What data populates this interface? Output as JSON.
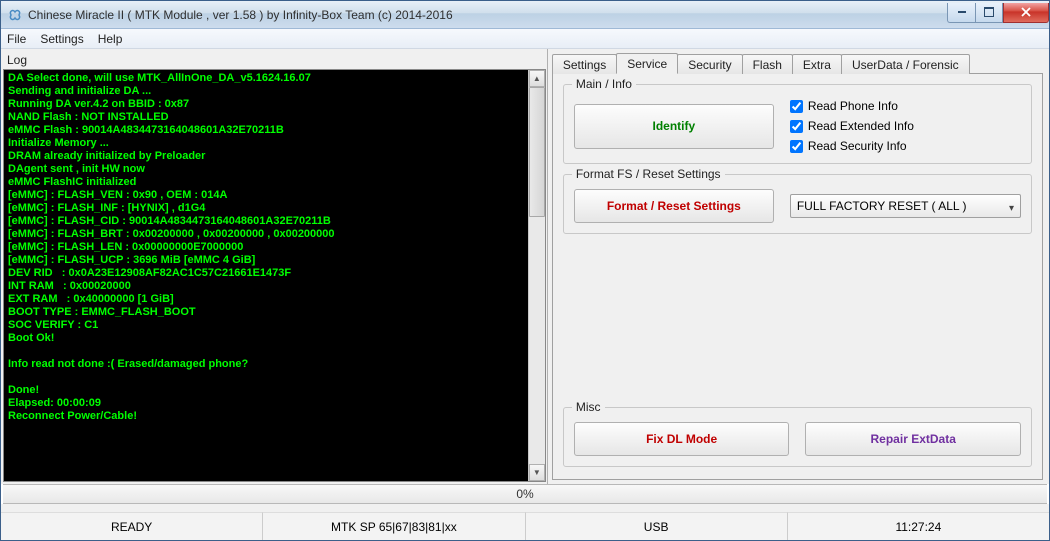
{
  "window": {
    "title": "Chinese Miracle II ( MTK Module , ver 1.58 ) by Infinity-Box Team (c) 2014-2016"
  },
  "menu": {
    "file": "File",
    "settings": "Settings",
    "help": "Help"
  },
  "log": {
    "label": "Log",
    "lines": "DA Select done, will use MTK_AllInOne_DA_v5.1624.16.07\nSending and initialize DA ...\nRunning DA ver.4.2 on BBID : 0x87\nNAND Flash : NOT INSTALLED\neMMC Flash : 90014A4834473164048601A32E70211B\nInitialize Memory ...\nDRAM already initialized by Preloader\nDAgent sent , init HW now\neMMC FlashIC initialized\n[eMMC] : FLASH_VEN : 0x90 , OEM : 014A\n[eMMC] : FLASH_INF : [HYNIX] , d1G4\n[eMMC] : FLASH_CID : 90014A4834473164048601A32E70211B\n[eMMC] : FLASH_BRT : 0x00200000 , 0x00200000 , 0x00200000\n[eMMC] : FLASH_LEN : 0x00000000E7000000\n[eMMC] : FLASH_UCP : 3696 MiB [eMMC 4 GiB]\nDEV RID   : 0x0A23E12908AF82AC1C57C21661E1473F\nINT RAM   : 0x00020000\nEXT RAM   : 0x40000000 [1 GiB]\nBOOT TYPE : EMMC_FLASH_BOOT\nSOC VERIFY : C1\nBoot Ok!\n\nInfo read not done :( Erased/damaged phone?\n\nDone!\nElapsed: 00:00:09\nReconnect Power/Cable!"
  },
  "tabs": {
    "settings": "Settings",
    "service": "Service",
    "security": "Security",
    "flash": "Flash",
    "extra": "Extra",
    "userdata": "UserData / Forensic"
  },
  "service": {
    "main_group": "Main / Info",
    "identify": "Identify",
    "read_phone": "Read Phone Info",
    "read_extended": "Read Extended Info",
    "read_security": "Read Security Info",
    "format_group": "Format FS / Reset Settings",
    "format_btn": "Format / Reset Settings",
    "format_select": "FULL FACTORY RESET ( ALL )",
    "misc_group": "Misc",
    "fix_dl": "Fix DL Mode",
    "repair_ext": "Repair ExtData"
  },
  "progress": {
    "text": "0%"
  },
  "status": {
    "ready": "READY",
    "device": "MTK SP 65|67|83|81|xx",
    "conn": "USB",
    "time": "11:27:24"
  }
}
